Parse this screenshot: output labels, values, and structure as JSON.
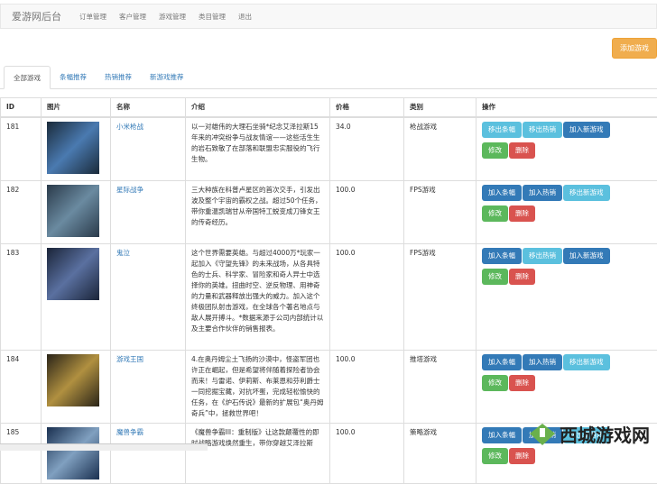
{
  "nav": {
    "brand": "爱游网后台",
    "items": [
      "订单管理",
      "客户管理",
      "游戏管理",
      "类目管理",
      "退出"
    ]
  },
  "add_button": "添加游戏",
  "tabs": [
    "全部游戏",
    "条幅推荐",
    "热销推荐",
    "新游戏推荐"
  ],
  "table": {
    "headers": [
      "ID",
      "图片",
      "名称",
      "介绍",
      "价格",
      "类别",
      "操作"
    ],
    "rows": [
      {
        "id": "181",
        "name": "小米枪战",
        "desc": "以一对雄伟的大理石坐骑*纪念艾泽拉斯15年来的冲突纷争与战友情谊——这些活生生的岩石致敬了在部落和联盟忠实服役的飞行生物。",
        "price": "34.0",
        "category": "枪战游戏",
        "img": [
          "#1a2a3a",
          "#4a7ab0"
        ],
        "actions": [
          [
            "移出条幅",
            "info"
          ],
          [
            "移出热销",
            "info"
          ],
          [
            "加入新游戏",
            "primary"
          ]
        ]
      },
      {
        "id": "182",
        "name": "星际战争",
        "desc": "三大种族在科普卢星区的首次交手，引发出波及整个宇宙的霸权之战。超过50个任务，带你重温凯瑞甘从帝国特工蜕变成刀锋女王的传奇经历。",
        "price": "100.0",
        "category": "FPS游戏",
        "img": [
          "#2a3a4a",
          "#6a8aa0"
        ],
        "actions": [
          [
            "加入条幅",
            "primary"
          ],
          [
            "加入热销",
            "primary"
          ],
          [
            "移出新游戏",
            "info"
          ]
        ]
      },
      {
        "id": "183",
        "name": "鬼泣",
        "desc": "这个世界需要英雄。与超过4000万*玩家一起加入《守望先锋》的未来战场，从各具特色的士兵、科学家、冒险家和奇人异士中选择你的英雄。扭曲时空、逆反物理、用神奇的力量和武器释放出强大的威力。加入这个终极团队射击游戏，在全球各个著名地点与敌人展开搏斗。*数据来源于公司内部统计以及主要合作伙伴的销售报表。",
        "price": "100.0",
        "category": "FPS游戏",
        "img": [
          "#1a2438",
          "#5a70a0"
        ],
        "actions": [
          [
            "加入条幅",
            "primary"
          ],
          [
            "移出热销",
            "info"
          ],
          [
            "加入新游戏",
            "primary"
          ]
        ]
      },
      {
        "id": "184",
        "name": "游戏王国",
        "desc": "4.在奥丹姆尘土飞扬的沙漠中，怪盗军团也许正在崛起，但是希望将伴随着探险者协会而来！与雷诺、伊莉斯、布莱恩和芬利爵士一同挖掘宝藏，对抗坏蛋，完成轻松愉快的任务，在《炉石传说》最新的扩展包“奥丹姆奇兵”中，拯救世界吧！",
        "price": "100.0",
        "category": "推塔游戏",
        "img": [
          "#2a2418",
          "#b09040"
        ],
        "actions": [
          [
            "加入条幅",
            "primary"
          ],
          [
            "加入热销",
            "primary"
          ],
          [
            "移出新游戏",
            "info"
          ]
        ]
      },
      {
        "id": "185",
        "name": "魔兽争霸",
        "desc": "《魔兽争霸III：重制版》让这款颠覆性的即时战略游戏焕然重生，带你穿越艾泽拉斯",
        "price": "100.0",
        "category": "策略游戏",
        "img": [
          "#1a3050",
          "#80a0c0"
        ],
        "actions": [
          [
            "加入条幅",
            "primary"
          ],
          [
            "加入热销",
            "primary"
          ],
          [
            "移出新游戏",
            "info"
          ]
        ]
      }
    ],
    "edit": "修改",
    "delete": "删除"
  },
  "watermark": "西城游戏网",
  "colors": {
    "info": "#5bc0de",
    "primary": "#337ab7",
    "success": "#5cb85c",
    "danger": "#d9534f",
    "warning": "#f0ad4e"
  }
}
